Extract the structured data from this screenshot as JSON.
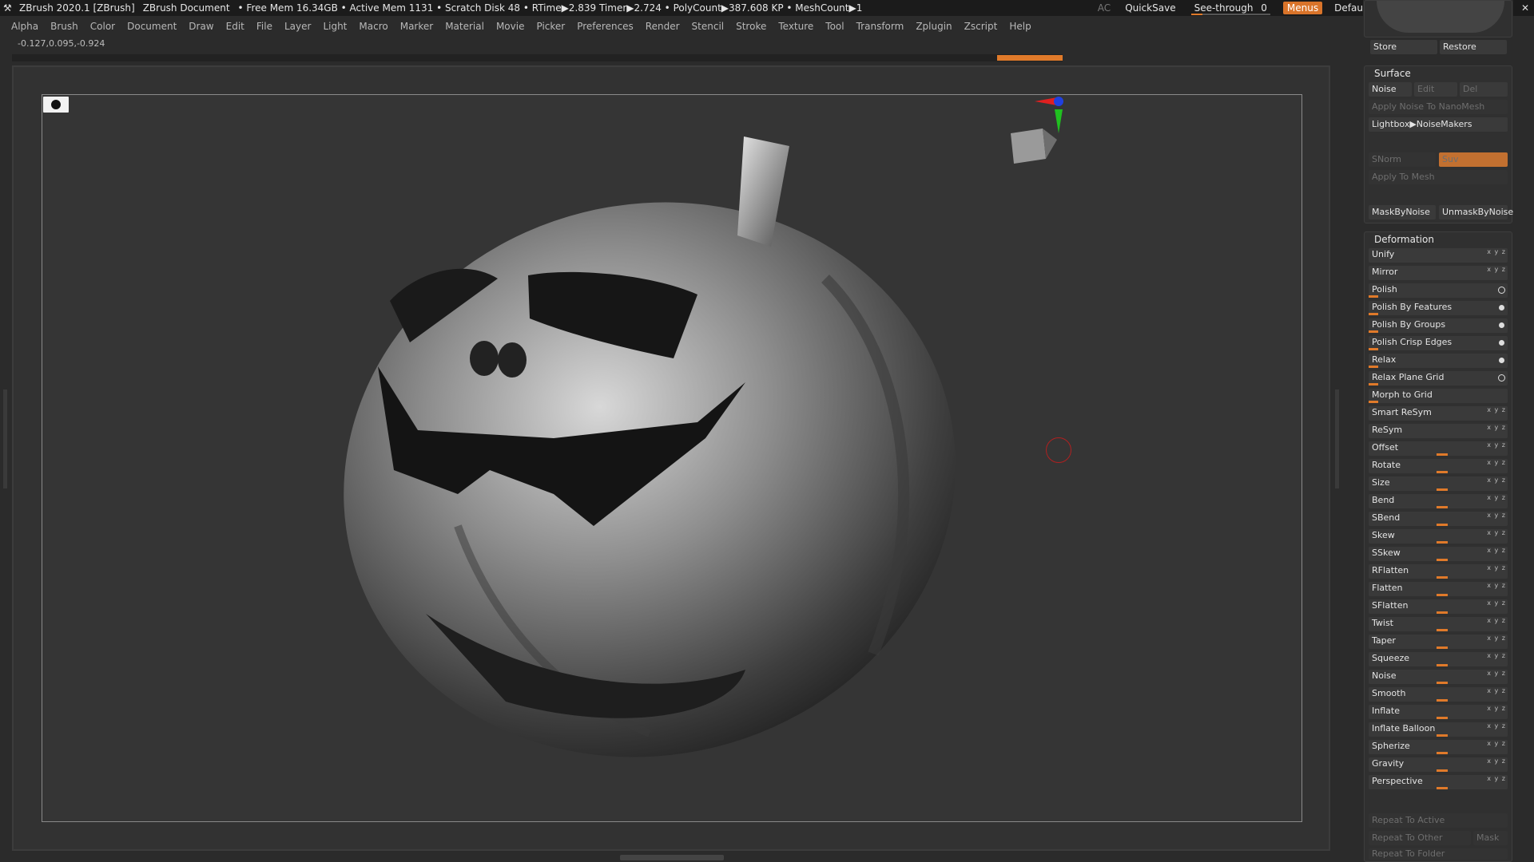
{
  "titlebar": {
    "app_title": "ZBrush 2020.1 [ZBrush]",
    "document": "ZBrush Document",
    "stats": "• Free Mem 16.34GB • Active Mem 1131 • Scratch Disk 48 • RTime▶2.839 Timer▶2.724 • PolyCount▶387.608 KP • MeshCount▶1",
    "ac": "AC",
    "quicksave": "QuickSave",
    "see_through_label": "See-through",
    "see_through_value": "0",
    "menus": "Menus",
    "script": "DefaultZScript"
  },
  "menubar": [
    "Alpha",
    "Brush",
    "Color",
    "Document",
    "Draw",
    "Edit",
    "File",
    "Layer",
    "Light",
    "Macro",
    "Marker",
    "Material",
    "Movie",
    "Picker",
    "Preferences",
    "Render",
    "Stencil",
    "Stroke",
    "Texture",
    "Tool",
    "Transform",
    "Zplugin",
    "Zscript",
    "Help"
  ],
  "coords": "-0.127,0.095,-0.924",
  "colors": {
    "accent": "#e07a2a",
    "gizmo_x": "#e02020",
    "gizmo_y": "#20c020",
    "gizmo_z": "#2040e0"
  },
  "rightpanel": {
    "store": "Store",
    "restore": "Restore",
    "surface": {
      "title": "Surface",
      "noise": "Noise",
      "edit": "Edit",
      "del": "Del",
      "apply_nano": "Apply Noise To NanoMesh",
      "lightbox": "Lightbox▶NoiseMakers",
      "snorm": "SNorm",
      "suv": "Suv",
      "apply_mesh": "Apply To Mesh",
      "mask_by_noise": "MaskByNoise",
      "unmask_by_noise": "UnmaskByNoise"
    },
    "deformation": {
      "title": "Deformation",
      "items": [
        {
          "label": "Unify",
          "kind": "axes"
        },
        {
          "label": "Mirror",
          "kind": "axes"
        },
        {
          "label": "Polish",
          "kind": "ring"
        },
        {
          "label": "Polish By Features",
          "kind": "dot"
        },
        {
          "label": "Polish By Groups",
          "kind": "dot"
        },
        {
          "label": "Polish Crisp Edges",
          "kind": "dot"
        },
        {
          "label": "Relax",
          "kind": "dot"
        },
        {
          "label": "Relax Plane Grid",
          "kind": "ring"
        },
        {
          "label": "Morph to Grid",
          "kind": "none"
        },
        {
          "label": "Smart ReSym",
          "kind": "axes"
        },
        {
          "label": "ReSym",
          "kind": "axes"
        },
        {
          "label": "Offset",
          "kind": "slider"
        },
        {
          "label": "Rotate",
          "kind": "slider"
        },
        {
          "label": "Size",
          "kind": "slider"
        },
        {
          "label": "Bend",
          "kind": "slider"
        },
        {
          "label": "SBend",
          "kind": "slider"
        },
        {
          "label": "Skew",
          "kind": "slider"
        },
        {
          "label": "SSkew",
          "kind": "slider"
        },
        {
          "label": "RFlatten",
          "kind": "slider"
        },
        {
          "label": "Flatten",
          "kind": "slider"
        },
        {
          "label": "SFlatten",
          "kind": "slider"
        },
        {
          "label": "Twist",
          "kind": "slider"
        },
        {
          "label": "Taper",
          "kind": "slider"
        },
        {
          "label": "Squeeze",
          "kind": "slider"
        },
        {
          "label": "Noise",
          "kind": "slider"
        },
        {
          "label": "Smooth",
          "kind": "slider"
        },
        {
          "label": "Inflate",
          "kind": "slider"
        },
        {
          "label": "Inflate Balloon",
          "kind": "slider"
        },
        {
          "label": "Spherize",
          "kind": "slider"
        },
        {
          "label": "Gravity",
          "kind": "slider"
        },
        {
          "label": "Perspective",
          "kind": "slider"
        }
      ],
      "axes_glyph": "x y z",
      "repeat_to_active": "Repeat To Active",
      "repeat_to_other": "Repeat To Other",
      "mask": "Mask",
      "repeat_to_folder": "Repeat To Folder"
    }
  }
}
